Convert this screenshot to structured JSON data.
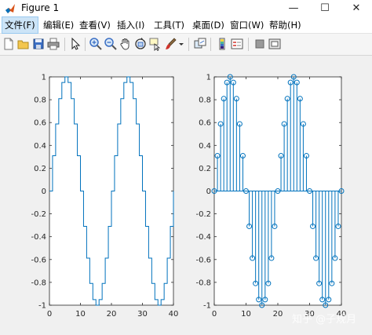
{
  "window": {
    "title": "Figure 1",
    "min_glyph": "—",
    "max_glyph": "☐",
    "close_glyph": "✕"
  },
  "menu": [
    {
      "label": "文件(F)",
      "active": true
    },
    {
      "label": "编辑(E)"
    },
    {
      "label": "查看(V)"
    },
    {
      "label": "插入(I)"
    },
    {
      "label": "工具(T)"
    },
    {
      "label": "桌面(D)"
    },
    {
      "label": "窗口(W)"
    },
    {
      "label": "帮助(H)"
    }
  ],
  "toolbar": {
    "icons": [
      "new-file-icon",
      "open-folder-icon",
      "save-icon",
      "print-icon",
      "pointer-icon",
      "zoom-in-icon",
      "zoom-out-icon",
      "pan-hand-icon",
      "rotate-3d-icon",
      "data-cursor-icon",
      "brush-icon",
      "brush-dropdown-icon",
      "link-plot-icon",
      "colorbar-icon",
      "legend-icon",
      "hide-plot-tools-icon",
      "show-plot-tools-icon"
    ]
  },
  "colors": {
    "line": "#0072bd",
    "axes_bg": "#ffffff",
    "figure_bg": "#f0f0f0"
  },
  "chart_data": [
    {
      "type": "stairs",
      "x": [
        0,
        1,
        2,
        3,
        4,
        5,
        6,
        7,
        8,
        9,
        10,
        11,
        12,
        13,
        14,
        15,
        16,
        17,
        18,
        19,
        20,
        21,
        22,
        23,
        24,
        25,
        26,
        27,
        28,
        29,
        30,
        31,
        32,
        33,
        34,
        35,
        36,
        37,
        38,
        39,
        40
      ],
      "y": [
        0,
        0.309,
        0.588,
        0.809,
        0.951,
        1,
        0.951,
        0.809,
        0.588,
        0.309,
        0,
        -0.309,
        -0.588,
        -0.809,
        -0.951,
        -1,
        -0.951,
        -0.809,
        -0.588,
        -0.309,
        0,
        0.309,
        0.588,
        0.809,
        0.951,
        1,
        0.951,
        0.809,
        0.588,
        0.309,
        0,
        -0.309,
        -0.588,
        -0.809,
        -0.951,
        -1,
        -0.951,
        -0.809,
        -0.588,
        -0.309,
        0
      ],
      "xlim": [
        0,
        40
      ],
      "ylim": [
        -1,
        1
      ],
      "xticks": [
        "0",
        "10",
        "20",
        "30",
        "40"
      ],
      "yticks": [
        "1",
        "0.8",
        "0.6",
        "0.4",
        "0.2",
        "0",
        "-0.2",
        "-0.4",
        "-0.6",
        "-0.8",
        "-1"
      ],
      "grid": false
    },
    {
      "type": "stem",
      "x": [
        0,
        1,
        2,
        3,
        4,
        5,
        6,
        7,
        8,
        9,
        10,
        11,
        12,
        13,
        14,
        15,
        16,
        17,
        18,
        19,
        20,
        21,
        22,
        23,
        24,
        25,
        26,
        27,
        28,
        29,
        30,
        31,
        32,
        33,
        34,
        35,
        36,
        37,
        38,
        39,
        40
      ],
      "y": [
        0,
        0.309,
        0.588,
        0.809,
        0.951,
        1,
        0.951,
        0.809,
        0.588,
        0.309,
        0,
        -0.309,
        -0.588,
        -0.809,
        -0.951,
        -1,
        -0.951,
        -0.809,
        -0.588,
        -0.309,
        0,
        0.309,
        0.588,
        0.809,
        0.951,
        1,
        0.951,
        0.809,
        0.588,
        0.309,
        0,
        -0.309,
        -0.588,
        -0.809,
        -0.951,
        -1,
        -0.951,
        -0.809,
        -0.588,
        -0.309,
        0
      ],
      "xlim": [
        0,
        40
      ],
      "ylim": [
        -1,
        1
      ],
      "xticks": [
        "0",
        "10",
        "20",
        "30",
        "40"
      ],
      "yticks": [
        "1",
        "0.8",
        "0.6",
        "0.4",
        "0.2",
        "0",
        "-0.2",
        "-0.4",
        "-0.6",
        "-0.8",
        "-1"
      ],
      "grid": false
    }
  ],
  "watermark": "知乎 @子规月"
}
